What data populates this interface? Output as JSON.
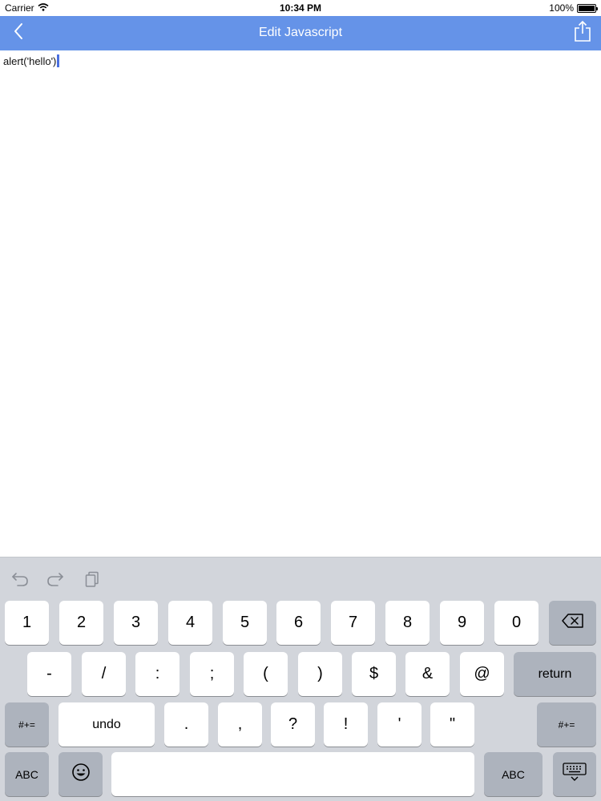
{
  "status_bar": {
    "carrier": "Carrier",
    "time": "10:34 PM",
    "battery": "100%"
  },
  "nav": {
    "title": "Edit Javascript",
    "back_icon": "chevron-left-icon",
    "share_icon": "share-icon"
  },
  "editor": {
    "content": "alert('hello')"
  },
  "keyboard": {
    "shortcut_icons": [
      "undo-icon",
      "redo-icon",
      "paste-icon"
    ],
    "row1": [
      "1",
      "2",
      "3",
      "4",
      "5",
      "6",
      "7",
      "8",
      "9",
      "0"
    ],
    "row2": [
      "-",
      "/",
      ":",
      ";",
      "(",
      ")",
      "$",
      "&",
      "@"
    ],
    "return_label": "return",
    "row3_left": "#+=",
    "undo_label": "undo",
    "row3": [
      ".",
      ",",
      "?",
      "!",
      "'",
      "\""
    ],
    "row3_right": "#+=",
    "abc_left": "ABC",
    "abc_right": "ABC"
  },
  "colors": {
    "nav_bar": "#6593e8",
    "keyboard_bg": "#d2d5db",
    "cursor": "#4a6fe0"
  }
}
